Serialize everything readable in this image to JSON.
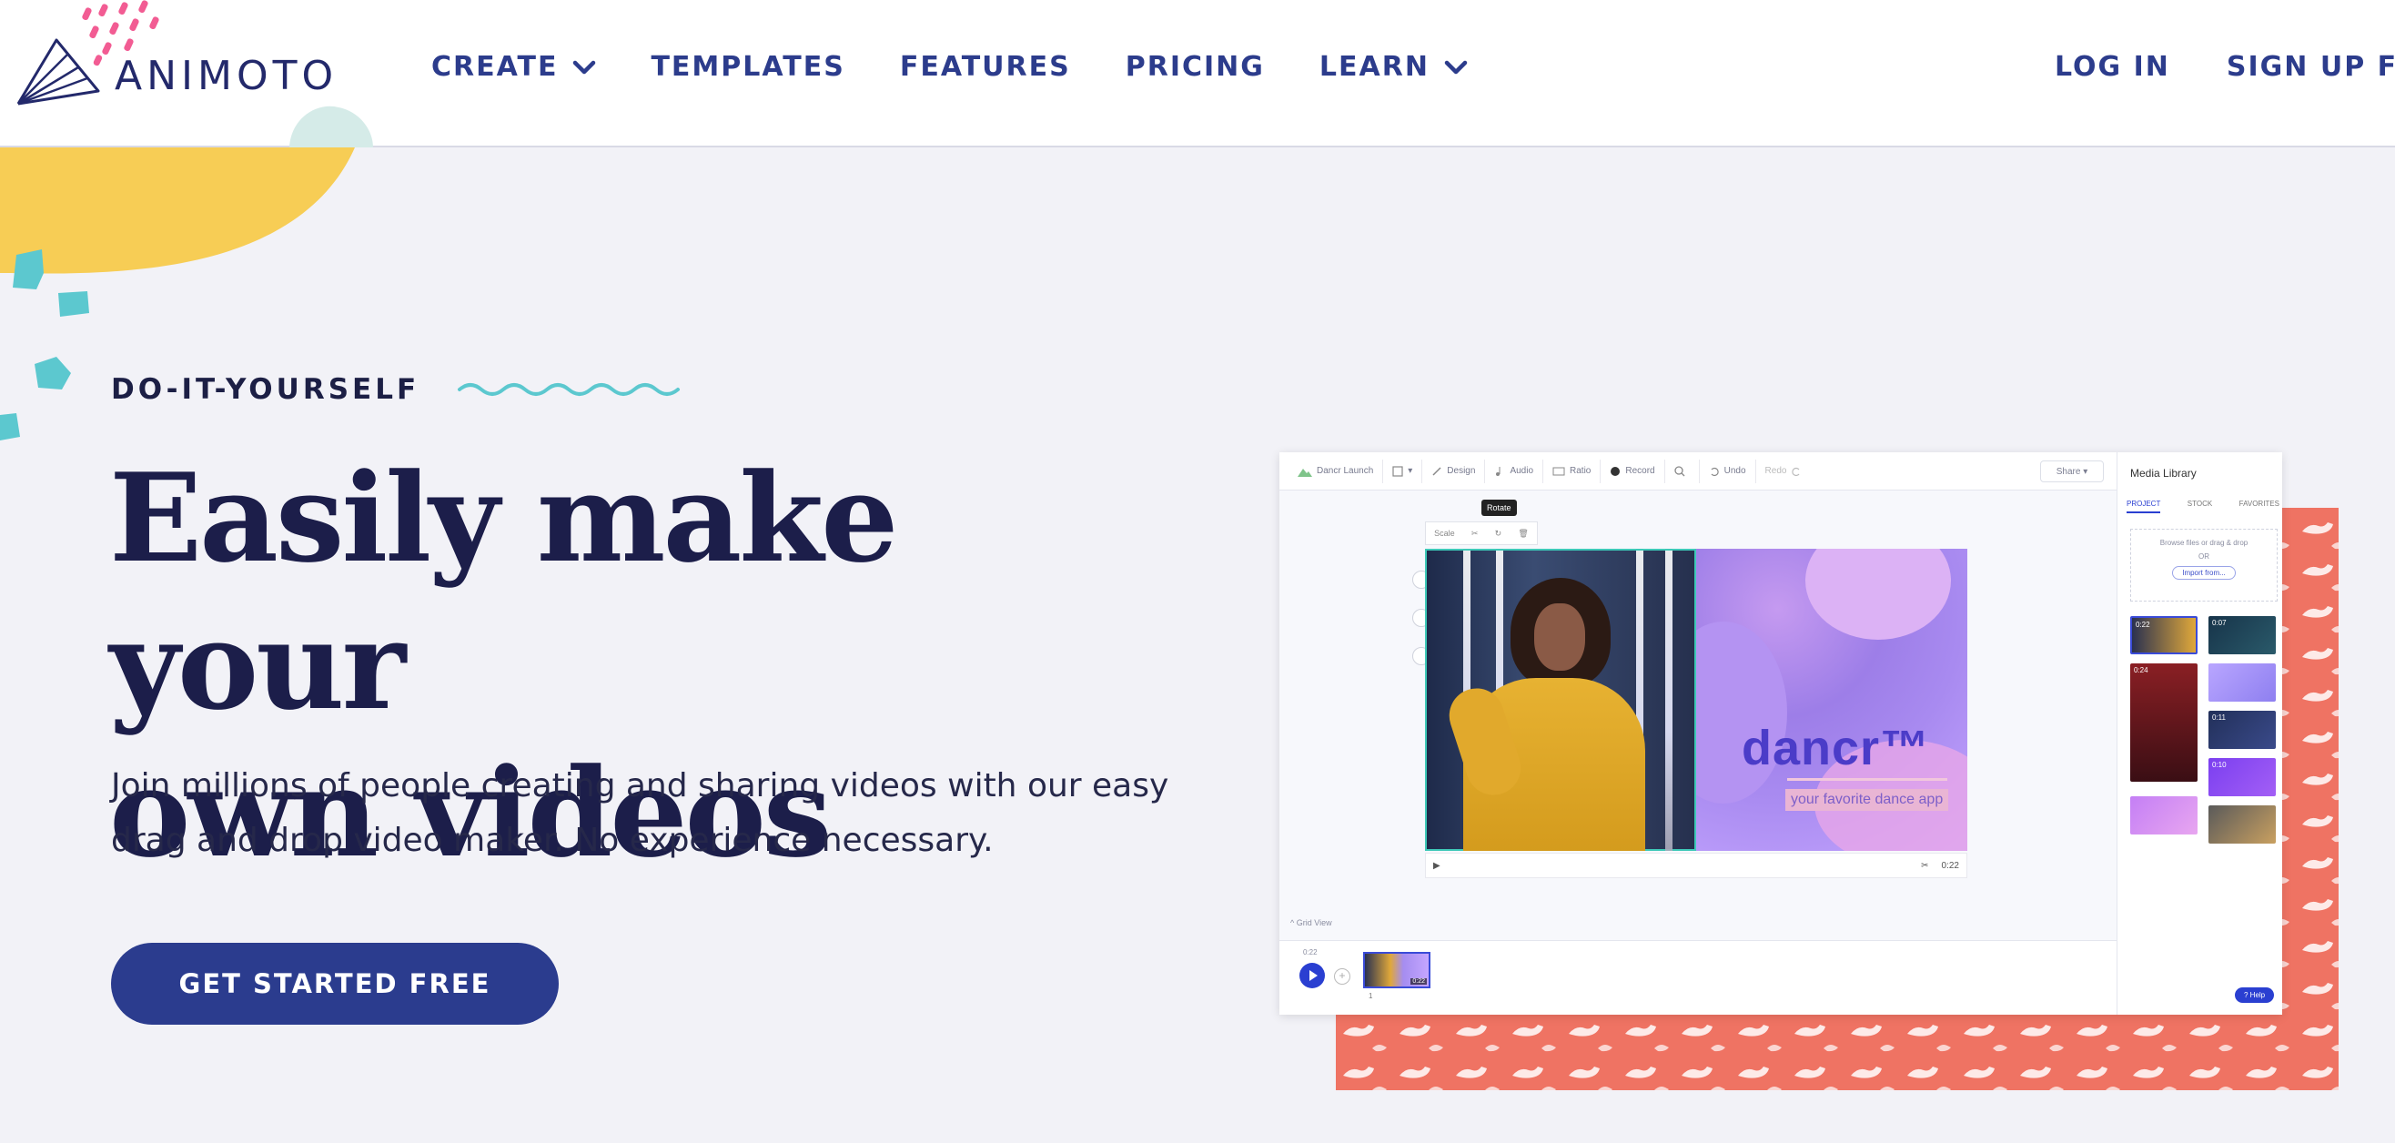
{
  "brand": {
    "name": "ANIMOTO"
  },
  "nav": {
    "items": [
      {
        "label": "CREATE",
        "dropdown": true
      },
      {
        "label": "TEMPLATES",
        "dropdown": false
      },
      {
        "label": "FEATURES",
        "dropdown": false
      },
      {
        "label": "PRICING",
        "dropdown": false
      },
      {
        "label": "LEARN",
        "dropdown": true
      }
    ],
    "login": "LOG IN",
    "signup": "SIGN UP FREE"
  },
  "hero": {
    "eyebrow": "DO-IT-YOURSELF",
    "headline_line1": "Easily make your",
    "headline_line2": "own videos",
    "subtext": "Join millions of people creating and sharing videos with our easy drag and drop video maker. No experience necessary.",
    "cta": "GET STARTED FREE"
  },
  "mockup": {
    "toolbar": {
      "project_name": "Dancr Launch",
      "design": "Design",
      "audio": "Audio",
      "ratio": "Ratio",
      "record": "Record",
      "undo": "Undo",
      "redo": "Redo",
      "share": "Share"
    },
    "tooltip": "Rotate",
    "scene_tools": {
      "scale": "Scale"
    },
    "brand_name": "dancr™",
    "brand_tag": "your favorite dance app",
    "duration": "0:22",
    "grid_view": "Grid View",
    "timeline_time": "0:22",
    "thumb_time": "0:22",
    "thumb_num": "1",
    "library": {
      "title": "Media Library",
      "tabs": [
        "PROJECT",
        "STOCK",
        "FAVORITES"
      ],
      "browse": "Browse files or drag & drop",
      "or": "OR",
      "import": "Import from...",
      "tile_times": [
        "0:22",
        "0:07",
        "0:24",
        "0:11",
        "0:10"
      ]
    },
    "help": "Help"
  },
  "colors": {
    "navy": "#1c1e4a",
    "nav_blue": "#2c3c8c",
    "cta_blue": "#2b3c8e",
    "coral": "#ef7363",
    "yellow": "#f7cd55",
    "teal": "#5cc8cf",
    "pink": "#f25c93"
  }
}
